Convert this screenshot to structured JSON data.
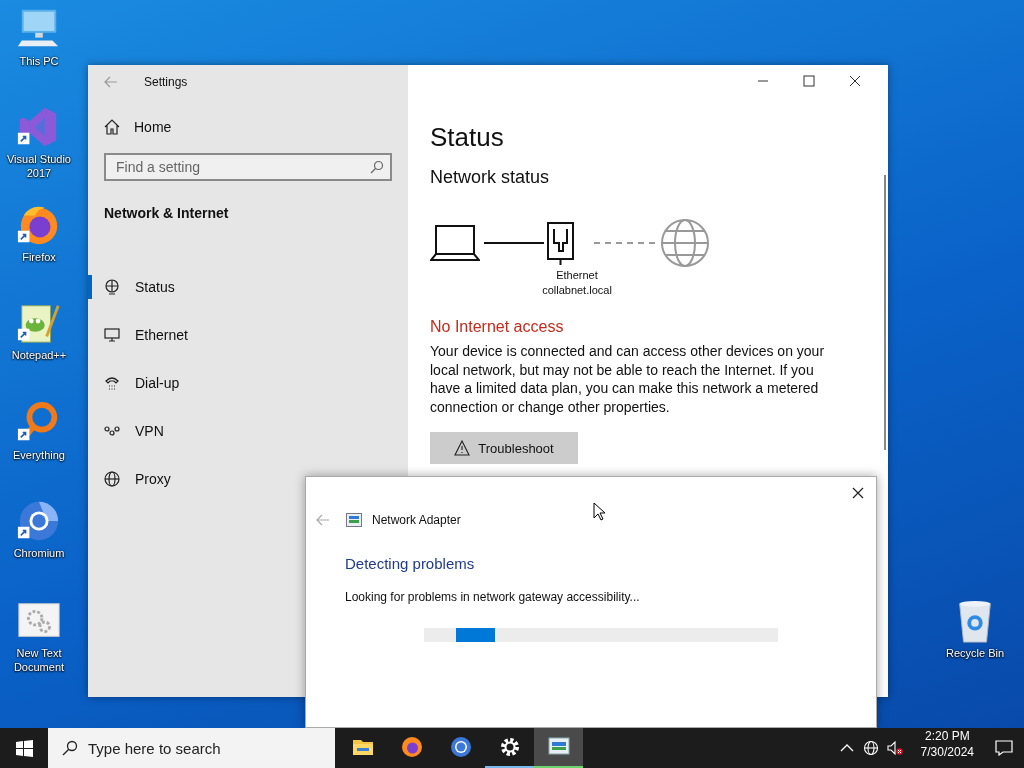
{
  "desktop_icons": [
    {
      "label": "This PC",
      "kind": "pc",
      "shortcut": false
    },
    {
      "label": "Visual Studio 2017",
      "kind": "vs",
      "shortcut": true
    },
    {
      "label": "Firefox",
      "kind": "firefox",
      "shortcut": true
    },
    {
      "label": "Notepad++",
      "kind": "notepad",
      "shortcut": true
    },
    {
      "label": "Everything",
      "kind": "everything",
      "shortcut": true
    },
    {
      "label": "Chromium",
      "kind": "chromium",
      "shortcut": true
    },
    {
      "label": "New Text Document",
      "kind": "document",
      "shortcut": false
    },
    {
      "label": "Recycle Bin",
      "kind": "recycle",
      "shortcut": false
    }
  ],
  "settings": {
    "title": "Settings",
    "home": "Home",
    "search": {
      "placeholder": "Find a setting"
    },
    "section": "Network & Internet",
    "nav": [
      {
        "label": "Status",
        "kind": "status",
        "selected": true
      },
      {
        "label": "Ethernet",
        "kind": "ethernet",
        "selected": false
      },
      {
        "label": "Dial-up",
        "kind": "dialup",
        "selected": false
      },
      {
        "label": "VPN",
        "kind": "vpn",
        "selected": false
      },
      {
        "label": "Proxy",
        "kind": "proxy",
        "selected": false
      }
    ],
    "page_title": "Status",
    "subtitle": "Network status",
    "diagram": {
      "adapter": "Ethernet",
      "network": "collabnet.local",
      "connected_to_internet": false
    },
    "alert": "No Internet access",
    "description": "Your device is connected and can access other devices on your local network, but may not be able to reach the Internet. If you have a limited data plan, you can make this network a metered connection or change other properties.",
    "button": "Troubleshoot"
  },
  "dialog": {
    "title": "Network Adapter",
    "heading": "Detecting problems",
    "message": "Looking for problems in network gateway accessibility...",
    "progress": {
      "level": 0.11
    }
  },
  "taskbar": {
    "search": {
      "placeholder": "Type here to search"
    },
    "apps": [
      {
        "kind": "explorer",
        "running": false,
        "active": false
      },
      {
        "kind": "firefox",
        "running": false,
        "active": false
      },
      {
        "kind": "chromium",
        "running": false,
        "active": false
      },
      {
        "kind": "settings",
        "running": true,
        "active": false
      },
      {
        "kind": "troubleshooter",
        "running": true,
        "active": true
      }
    ],
    "time": "2:20 PM",
    "date": "7/30/2024"
  }
}
